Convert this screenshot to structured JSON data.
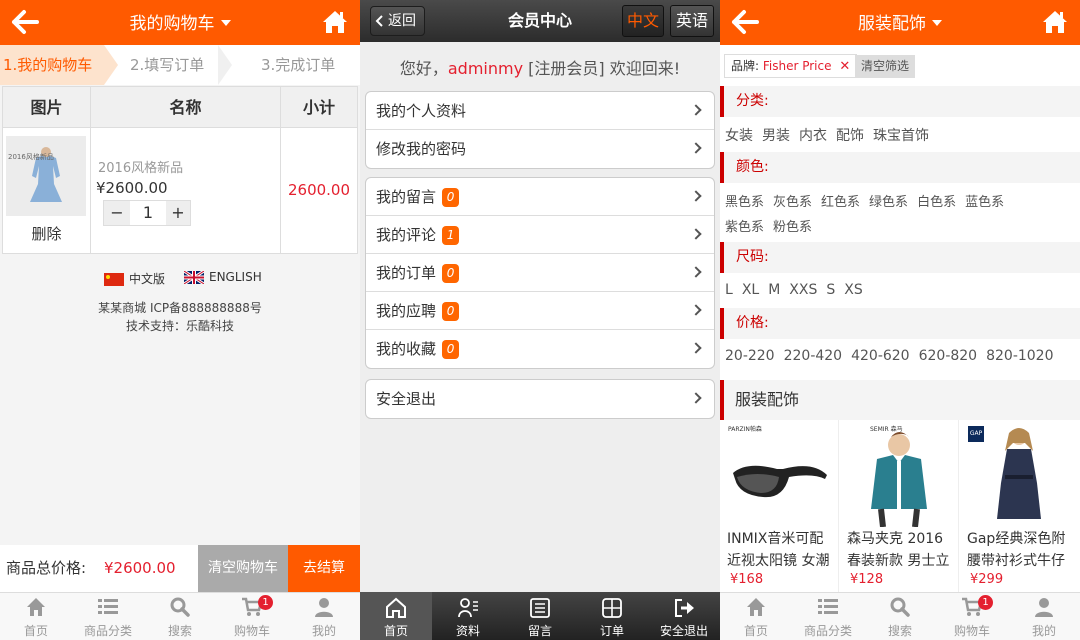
{
  "cart": {
    "title": "我的购物车",
    "steps": [
      "1.我的购物车",
      "2.填写订单",
      "3.完成订单"
    ],
    "headers": [
      "图片",
      "名称",
      "小计"
    ],
    "item": {
      "image_caption": "2016风格新品",
      "name": "2016风格新品",
      "price": "¥2600.00",
      "qty": "1",
      "subtotal": "2600.00",
      "delete": "删除"
    },
    "lang_cn": "中文版",
    "lang_en": "ENGLISH",
    "icp": "某某商城 ICP备888888888号",
    "support": "技术支持：乐酷科技",
    "total_label": "商品总价格:",
    "total_value": "¥2600.00",
    "clear_btn": "清空购物车",
    "checkout_btn": "去结算"
  },
  "tabbar": {
    "home": "首页",
    "category": "商品分类",
    "search": "搜索",
    "cart": "购物车",
    "mine": "我的",
    "cart_badge": "1"
  },
  "member": {
    "back": "返回",
    "title": "会员中心",
    "lang_cn": "中文",
    "lang_en": "英语",
    "greet_pre": "您好，",
    "username": "adminmy",
    "greet_post": "[注册会员] 欢迎回来!",
    "group1": [
      "我的个人资料",
      "修改我的密码"
    ],
    "group2": [
      {
        "label": "我的留言",
        "count": "0"
      },
      {
        "label": "我的评论",
        "count": "1"
      },
      {
        "label": "我的订单",
        "count": "0"
      },
      {
        "label": "我的应聘",
        "count": "0"
      },
      {
        "label": "我的收藏",
        "count": "0"
      }
    ],
    "logout": "安全退出",
    "tabs": [
      "首页",
      "资料",
      "留言",
      "订单",
      "安全退出"
    ]
  },
  "filter": {
    "title": "服装配饰",
    "tag_label": "品牌:",
    "tag_value": "Fisher Price",
    "clear": "清空筛选",
    "cat_label": "分类:",
    "cats": [
      "女装",
      "男装",
      "内衣",
      "配饰",
      "珠宝首饰"
    ],
    "color_label": "颜色:",
    "colors1": [
      "黑色系",
      "灰色系",
      "红色系",
      "绿色系",
      "白色系",
      "蓝色系"
    ],
    "colors2": [
      "紫色系",
      "粉色系"
    ],
    "size_label": "尺码:",
    "sizes": [
      "L",
      "XL",
      "M",
      "XXS",
      "S",
      "XS"
    ],
    "price_label": "价格:",
    "prices": [
      "20-220",
      "220-420",
      "420-620",
      "620-820",
      "820-1020"
    ],
    "section": "服装配饰",
    "products": [
      {
        "name": "INMIX音米可配近视太阳镜 女潮",
        "price": "¥168",
        "brand": "PARZIN帕森"
      },
      {
        "name": "森马夹克 2016春装新款 男士立",
        "price": "¥128",
        "brand": "SEMIR 森马"
      },
      {
        "name": "Gap经典深色附腰带衬衫式牛仔",
        "price": "¥299",
        "brand": "GAP"
      }
    ]
  },
  "colors": {
    "orange": "#ff5a00",
    "red": "#e4202f",
    "dark": "#2c2c2c"
  }
}
